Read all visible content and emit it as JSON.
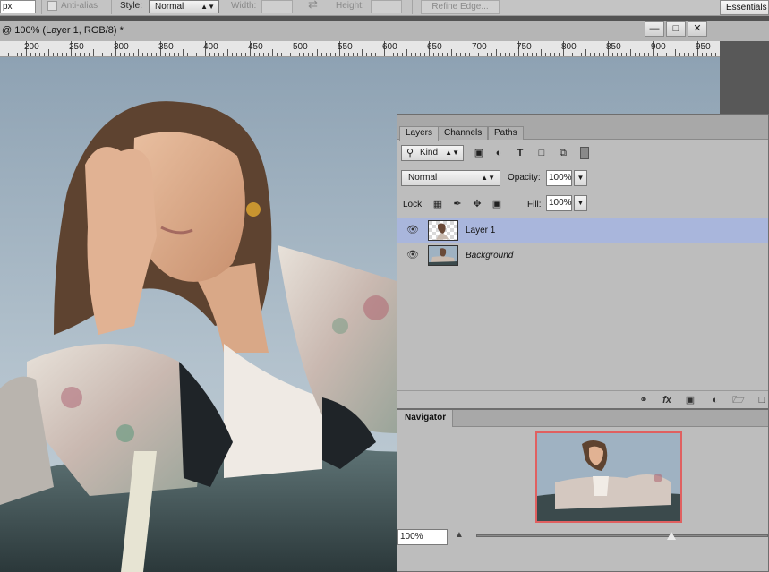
{
  "options_bar": {
    "feather_unit": "px",
    "anti_alias": "Anti-alias",
    "style_label": "Style:",
    "style_value": "Normal",
    "width_label": "Width:",
    "height_label": "Height:",
    "refine_edge": "Refine Edge...",
    "workspace": "Essentials"
  },
  "document": {
    "title": "@ 100% (Layer 1, RGB/8) *",
    "minimize": "—",
    "restore": "□",
    "close": "✕"
  },
  "ruler": {
    "labels": [
      "200",
      "250",
      "300",
      "350",
      "400",
      "450",
      "500",
      "550",
      "600",
      "650",
      "700",
      "750",
      "800",
      "850",
      "900",
      "950"
    ]
  },
  "layers_panel": {
    "tabs": [
      "Layers",
      "Channels",
      "Paths"
    ],
    "kind_label": "Kind",
    "blend_mode": "Normal",
    "opacity_label": "Opacity:",
    "opacity_value": "100%",
    "lock_label": "Lock:",
    "fill_label": "Fill:",
    "fill_value": "100%",
    "layers": [
      {
        "name": "Layer 1",
        "selected": true,
        "visible": true
      },
      {
        "name": "Background",
        "selected": false,
        "visible": true
      }
    ],
    "filter_icons": [
      "image-filter-icon",
      "adjustment-filter-icon",
      "type-filter-icon",
      "shape-filter-icon",
      "smart-object-filter-icon"
    ],
    "lock_icons": [
      "lock-transparent-icon",
      "lock-pixels-icon",
      "lock-position-icon",
      "lock-all-icon"
    ],
    "bottom_icons": [
      "link-layers-icon",
      "fx-icon",
      "add-mask-icon",
      "adjustment-layer-icon",
      "new-group-icon",
      "new-layer-icon"
    ]
  },
  "navigator": {
    "tab": "Navigator",
    "zoom_value": "100%",
    "zoom_fraction": 0.67,
    "frame_color": "#e06060"
  },
  "colors": {
    "selected_layer": "#a9b6dc",
    "panel_bg": "#bdbdbd"
  }
}
